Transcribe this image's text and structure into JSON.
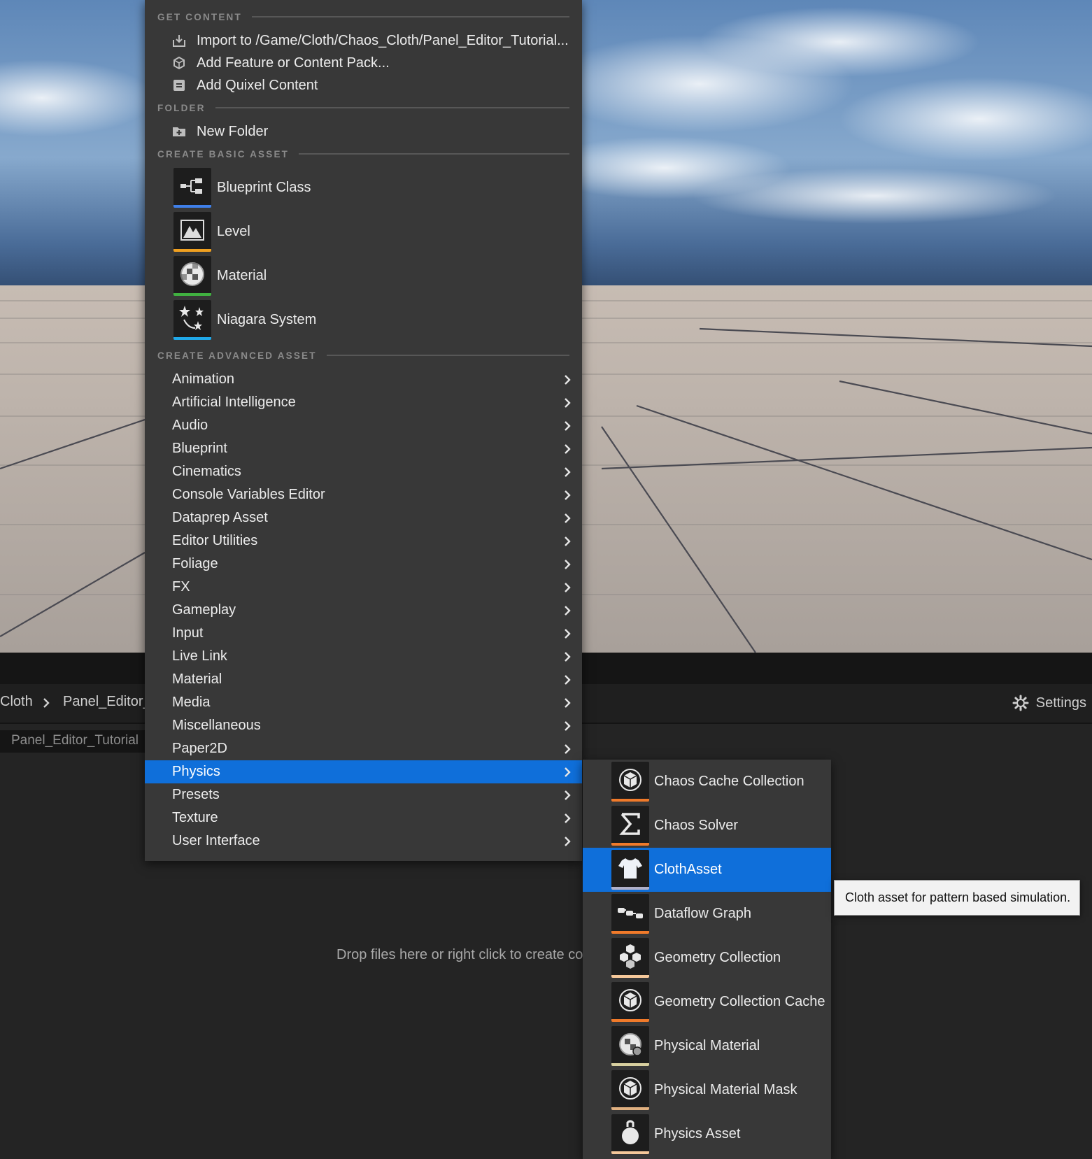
{
  "menu": {
    "get_content": {
      "header": "GET CONTENT",
      "items": [
        {
          "label": "Import to /Game/Cloth/Chaos_Cloth/Panel_Editor_Tutorial...",
          "icon": "import-icon"
        },
        {
          "label": "Add Feature or Content Pack...",
          "icon": "feature-pack-icon"
        },
        {
          "label": "Add Quixel Content",
          "icon": "quixel-icon"
        }
      ]
    },
    "folder": {
      "header": "FOLDER",
      "items": [
        {
          "label": "New Folder",
          "icon": "new-folder-icon"
        }
      ]
    },
    "basic_assets": {
      "header": "CREATE BASIC ASSET",
      "items": [
        {
          "label": "Blueprint Class",
          "icon": "blueprint-class-icon",
          "color": "#3f7fe8"
        },
        {
          "label": "Level",
          "icon": "level-icon",
          "color": "#f0a020"
        },
        {
          "label": "Material",
          "icon": "material-icon",
          "color": "#40b040"
        },
        {
          "label": "Niagara System",
          "icon": "niagara-icon",
          "color": "#20a8e8"
        }
      ]
    },
    "advanced_assets": {
      "header": "CREATE ADVANCED ASSET",
      "items": [
        "Animation",
        "Artificial Intelligence",
        "Audio",
        "Blueprint",
        "Cinematics",
        "Console Variables Editor",
        "Dataprep Asset",
        "Editor Utilities",
        "Foliage",
        "FX",
        "Gameplay",
        "Input",
        "Live Link",
        "Material",
        "Media",
        "Miscellaneous",
        "Paper2D",
        "Physics",
        "Presets",
        "Texture",
        "User Interface"
      ],
      "active": "Physics"
    }
  },
  "physics_submenu": {
    "items": [
      {
        "label": "Chaos Cache Collection",
        "icon": "chaos-cache-icon",
        "color": "#f07a2a"
      },
      {
        "label": "Chaos Solver",
        "icon": "chaos-solver-icon",
        "color": "#f07a2a"
      },
      {
        "label": "ClothAsset",
        "icon": "cloth-asset-icon",
        "color": "#b0b0c8"
      },
      {
        "label": "Dataflow Graph",
        "icon": "dataflow-graph-icon",
        "color": "#f07a2a"
      },
      {
        "label": "Geometry Collection",
        "icon": "geometry-collection-icon",
        "color": "#f5c89a"
      },
      {
        "label": "Geometry Collection Cache",
        "icon": "geometry-cache-icon",
        "color": "#f07a2a"
      },
      {
        "label": "Physical Material",
        "icon": "physical-material-icon",
        "color": "#d8d0a0"
      },
      {
        "label": "Physical Material Mask",
        "icon": "physical-material-mask-icon",
        "color": "#e0b080"
      },
      {
        "label": "Physics Asset",
        "icon": "physics-asset-icon",
        "color": "#f5c89a"
      }
    ],
    "active": "ClothAsset"
  },
  "tooltip": "Cloth asset for pattern based simulation.",
  "content_browser": {
    "breadcrumbs": [
      "Cloth",
      "Panel_Editor_"
    ],
    "path_field": "Panel_Editor_Tutorial",
    "settings_label": "Settings",
    "drop_hint": "Drop files here or right click to create co"
  },
  "colors": {
    "accent": "#0f6fda",
    "menu_bg": "#383838"
  }
}
